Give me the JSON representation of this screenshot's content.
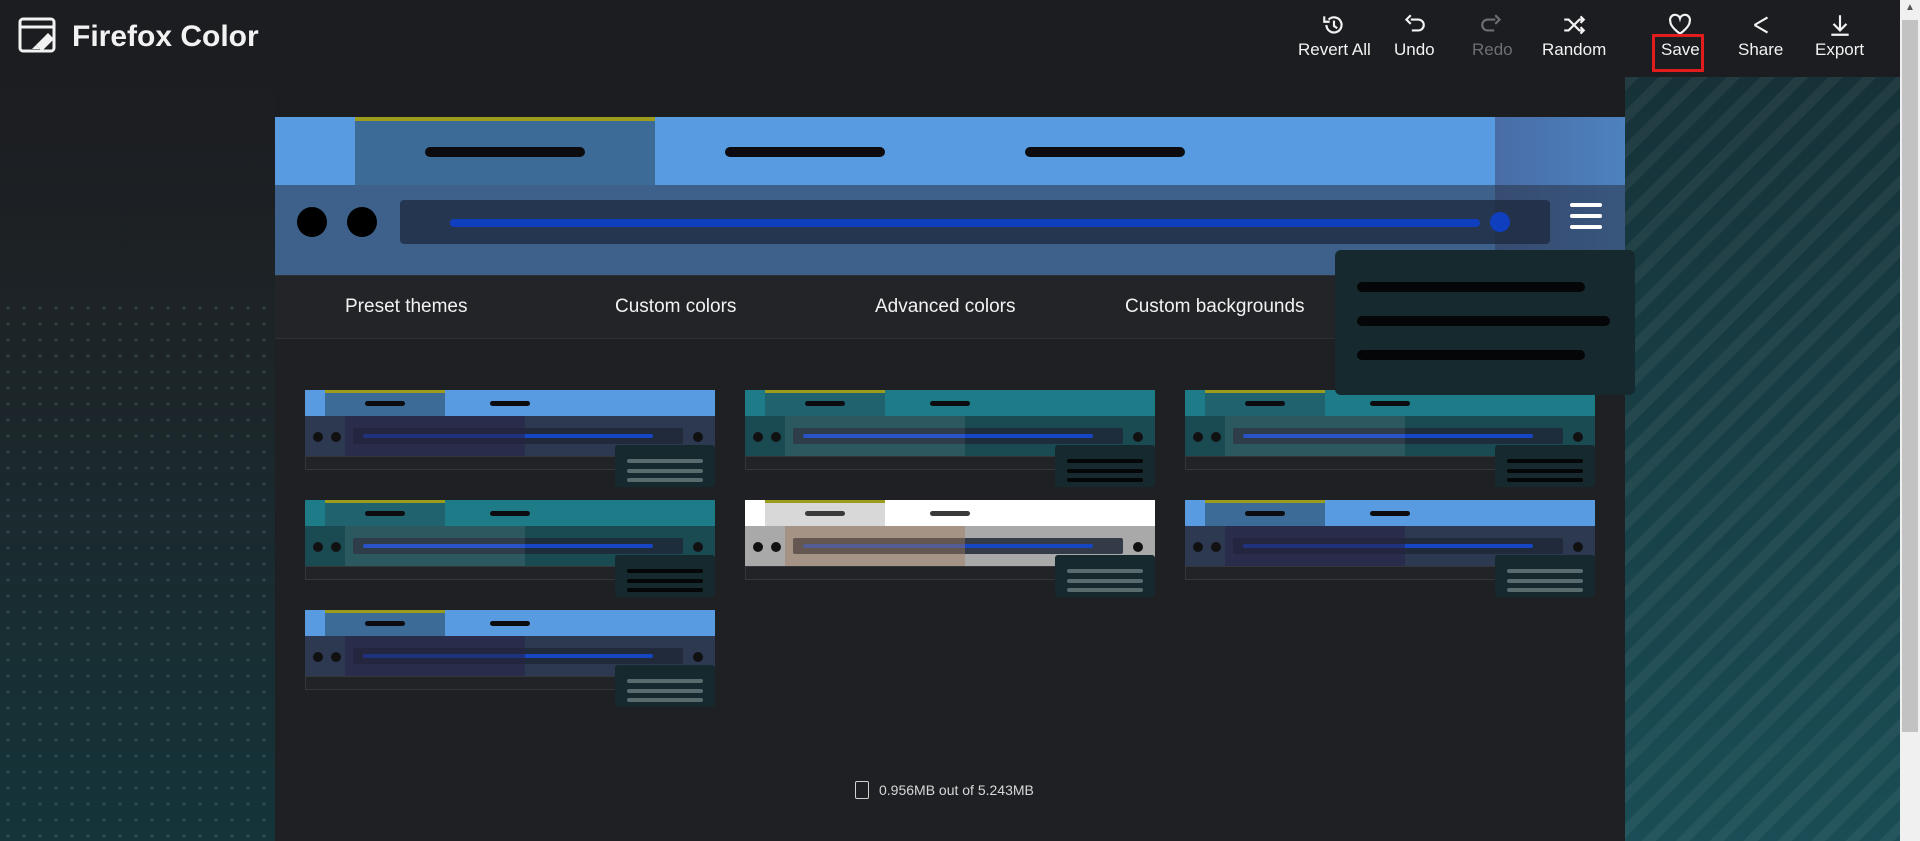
{
  "app": {
    "title": "Firefox Color"
  },
  "toolbar": {
    "revert_all": "Revert All",
    "undo": "Undo",
    "redo": "Redo",
    "random": "Random",
    "save": "Save",
    "share": "Share",
    "export": "Export"
  },
  "tabs": [
    {
      "label": "Preset themes"
    },
    {
      "label": "Custom colors"
    },
    {
      "label": "Advanced colors"
    },
    {
      "label": "Custom backgrounds"
    }
  ],
  "storage": {
    "text": "0.956MB out of 5.243MB"
  },
  "colors": {
    "accent_blue": "#589be0",
    "active_tab": "#3d6b98",
    "tab_line": "#9c9c1c",
    "url_bar": "#0f3fbf",
    "popup": "#16292e",
    "save_highlight": "#e01c1c"
  },
  "themes": [
    {
      "name": "theme-1",
      "style": "blue"
    },
    {
      "name": "theme-2",
      "style": "teal"
    },
    {
      "name": "theme-3",
      "style": "teal"
    },
    {
      "name": "theme-4",
      "style": "teal"
    },
    {
      "name": "theme-5",
      "style": "light"
    },
    {
      "name": "theme-6",
      "style": "blue"
    },
    {
      "name": "theme-7",
      "style": "blue"
    }
  ]
}
